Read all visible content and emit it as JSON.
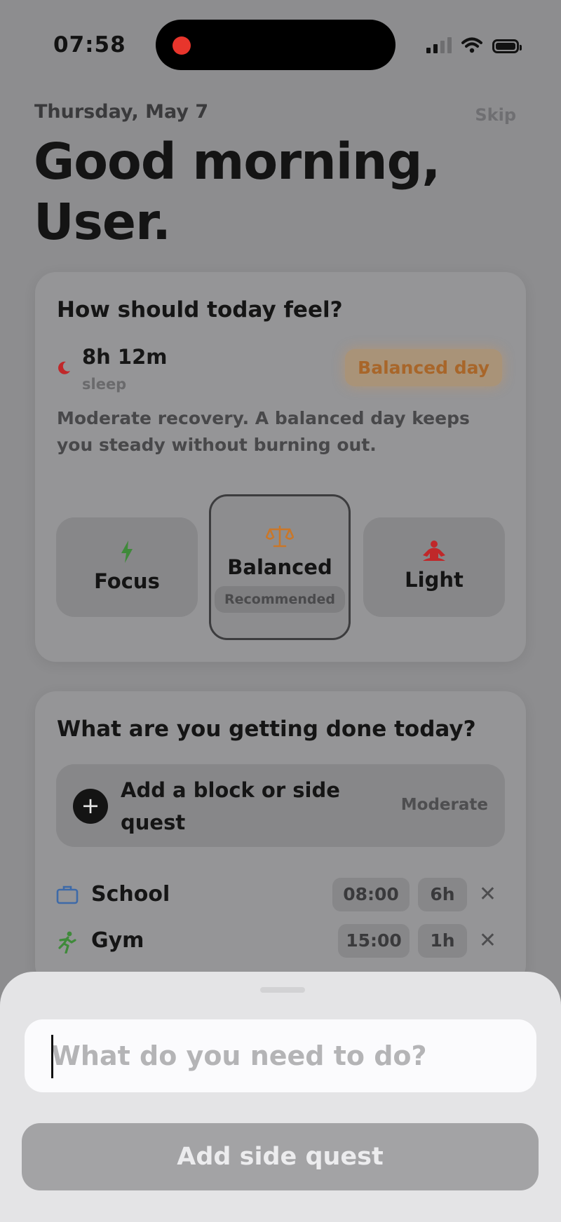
{
  "status_bar": {
    "time": "07:58"
  },
  "header": {
    "date": "Thursday, May 7",
    "skip_label": "Skip",
    "greeting_line1": "Good morning,",
    "greeting_line2": "User."
  },
  "mood_card": {
    "title": "How should today feel?",
    "sleep_value": "8h 12m",
    "sleep_label": "sleep",
    "badge": "Balanced day",
    "description": "Moderate recovery. A balanced day keeps you steady without burning out.",
    "modes": {
      "focus": {
        "label": "Focus",
        "icon": "lightning-icon"
      },
      "balanced": {
        "label": "Balanced",
        "icon": "scale-icon",
        "pill": "Recommended"
      },
      "light": {
        "label": "Light",
        "icon": "meditation-icon"
      }
    }
  },
  "tasks_card": {
    "title": "What are you getting done today?",
    "add_label": "Add a block or side quest",
    "add_meta": "Moderate",
    "tasks": [
      {
        "name": "School",
        "time": "08:00",
        "duration": "6h",
        "icon": "briefcase-icon"
      },
      {
        "name": "Gym",
        "time": "15:00",
        "duration": "1h",
        "icon": "runner-icon"
      }
    ],
    "remove_symbol": "✕",
    "plus_symbol": "+"
  },
  "sheet": {
    "input_placeholder": "What do you need to do?",
    "input_value": "",
    "submit_label": "Add side quest"
  },
  "colors": {
    "accent_orange": "#d9822b",
    "recording_red": "#e8352c",
    "sheet_background": "#e4e4e6"
  }
}
